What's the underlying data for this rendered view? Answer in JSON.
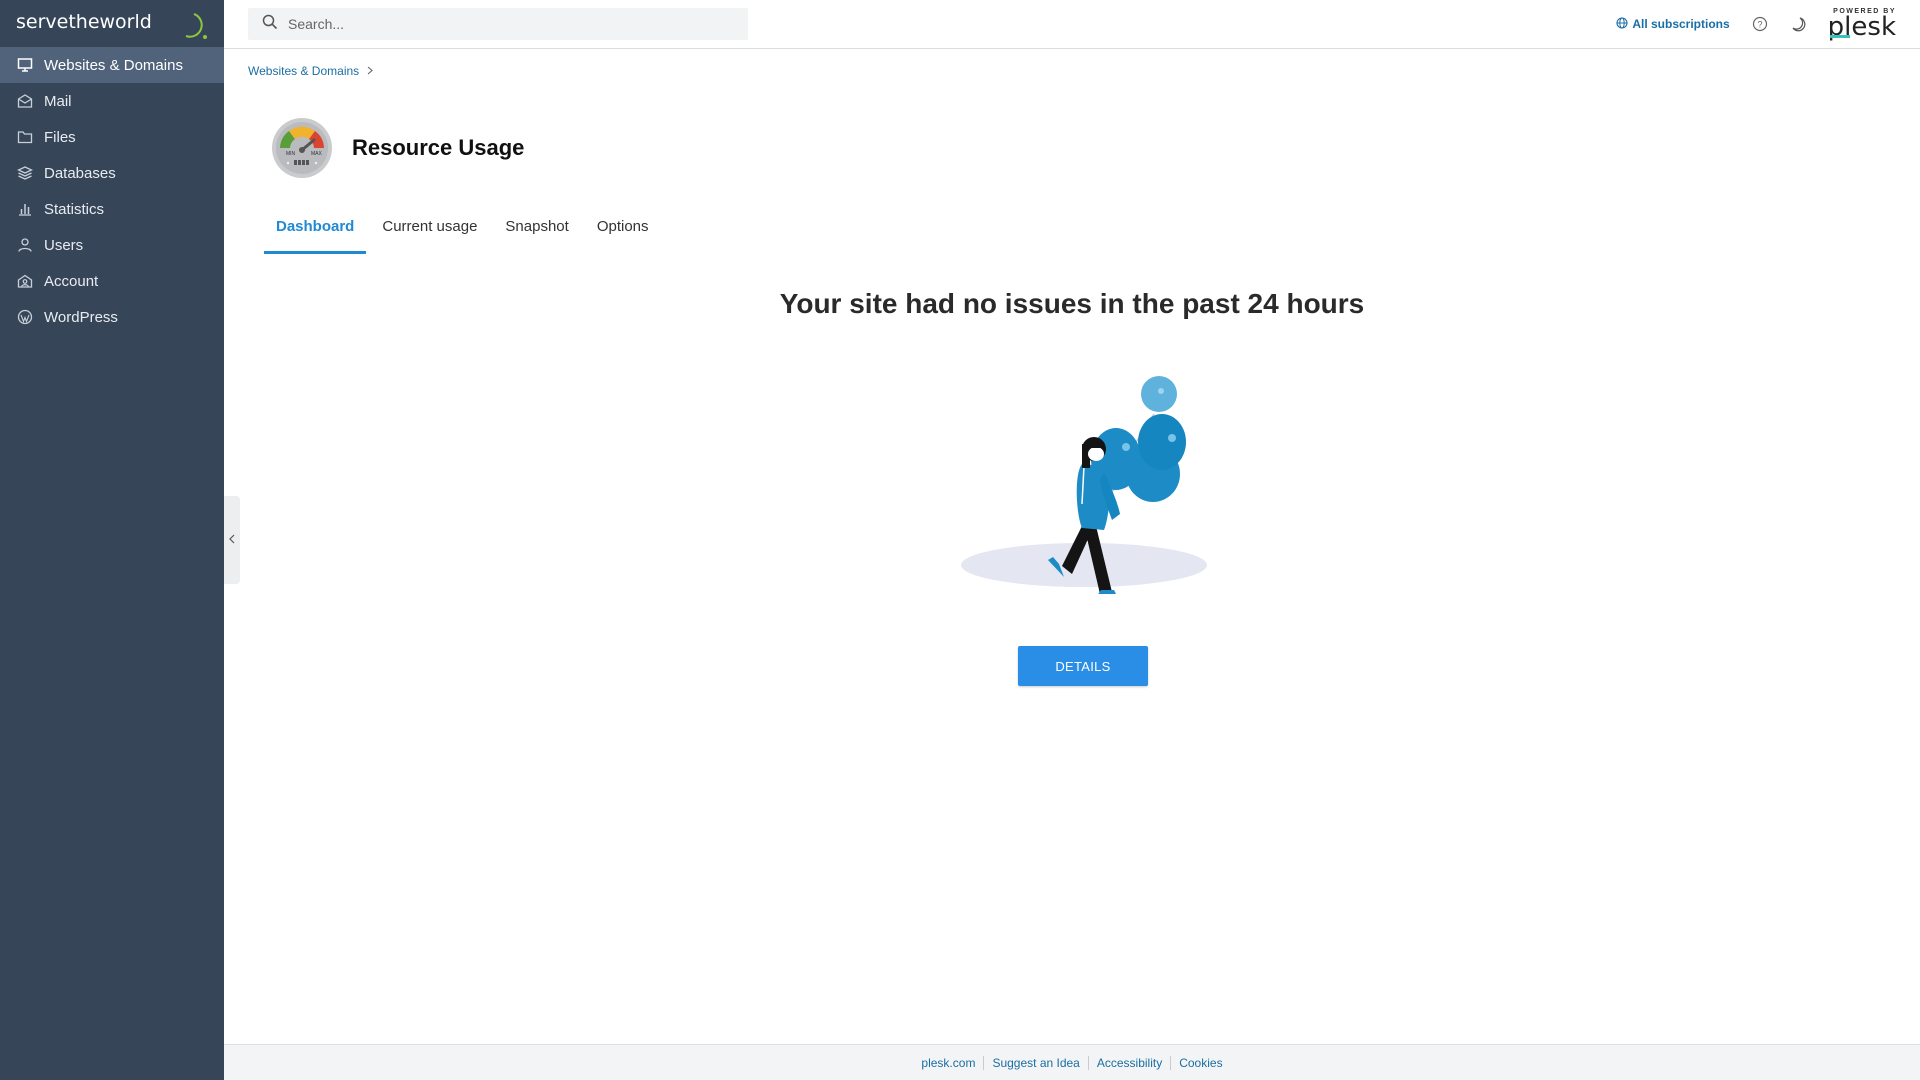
{
  "brand": {
    "logo_text": "servetheworld"
  },
  "sidebar": {
    "items": [
      {
        "label": "Websites & Domains",
        "icon": "monitor-icon",
        "active": true
      },
      {
        "label": "Mail",
        "icon": "mail-icon"
      },
      {
        "label": "Files",
        "icon": "folder-icon"
      },
      {
        "label": "Databases",
        "icon": "database-icon"
      },
      {
        "label": "Statistics",
        "icon": "chart-icon"
      },
      {
        "label": "Users",
        "icon": "user-icon"
      },
      {
        "label": "Account",
        "icon": "account-icon"
      },
      {
        "label": "WordPress",
        "icon": "wordpress-icon"
      }
    ]
  },
  "header": {
    "search_placeholder": "Search...",
    "subscriptions_label": "All subscriptions",
    "powered_by": "POWERED BY",
    "plesk": "plesk"
  },
  "breadcrumb": {
    "item": "Websites & Domains"
  },
  "page": {
    "title": "Resource Usage",
    "gauge_min": "MIN",
    "gauge_max": "MAX",
    "tabs": [
      {
        "label": "Dashboard",
        "active": true
      },
      {
        "label": "Current usage"
      },
      {
        "label": "Snapshot"
      },
      {
        "label": "Options"
      }
    ],
    "message": "Your site had no issues in the past 24 hours",
    "details_button": "DETAILS"
  },
  "footer": {
    "links": [
      "plesk.com",
      "Suggest an Idea",
      "Accessibility",
      "Cookies"
    ]
  },
  "colors": {
    "sidebar_bg": "#364558",
    "sidebar_active": "#51637a",
    "accent": "#1f8ad3",
    "button": "#2b8ee6",
    "link": "#1a6ea3"
  }
}
